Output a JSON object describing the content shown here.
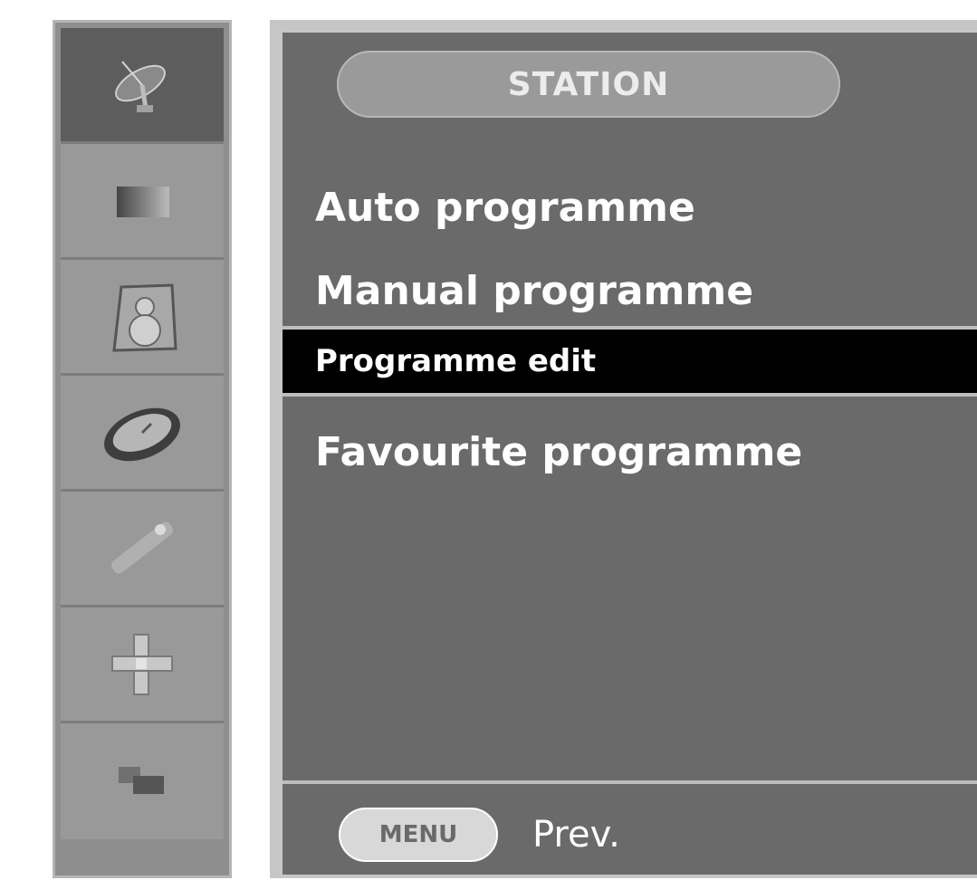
{
  "sidebar": {
    "icons": [
      {
        "name": "satellite-dish-icon",
        "active": true
      },
      {
        "name": "picture-icon",
        "active": false
      },
      {
        "name": "sound-icon",
        "active": false
      },
      {
        "name": "time-icon",
        "active": false
      },
      {
        "name": "option-icon",
        "active": false
      },
      {
        "name": "screen-adjust-icon",
        "active": false
      },
      {
        "name": "input-icon",
        "active": false
      }
    ]
  },
  "panel": {
    "title": "STATION",
    "items": [
      {
        "label": "Auto programme"
      },
      {
        "label": "Manual programme"
      },
      {
        "label": "Programme edit",
        "selected": true
      },
      {
        "label": "Favourite programme"
      }
    ],
    "footer": {
      "key_label": "MENU",
      "action_label": "Prev."
    }
  },
  "colors": {
    "panel_bg": "#6a6a6a",
    "selected_bg": "#000000",
    "text": "#ffffff"
  }
}
